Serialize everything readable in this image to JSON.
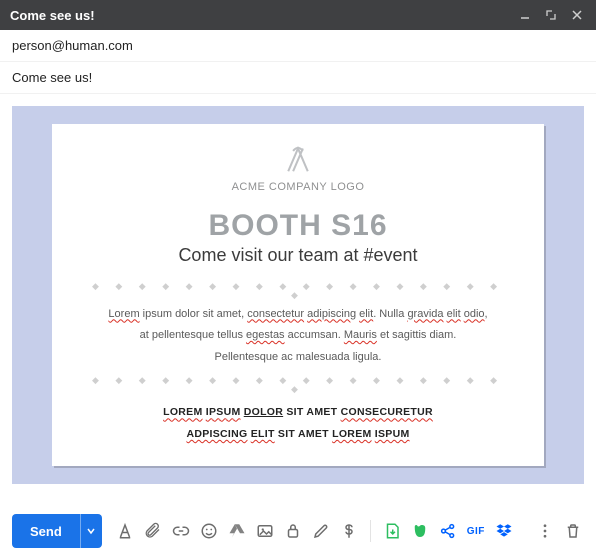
{
  "window": {
    "title": "Come see us!"
  },
  "to_field": "person@human.com",
  "subject": "Come see us!",
  "email": {
    "logo_text": "ACME COMPANY LOGO",
    "headline": "BOOTH S16",
    "tagline": "Come visit our team at #event",
    "body_line1_html": "<span class='sq'>Lorem</span> ipsum dolor sit amet, <span class='sq'>consectetur</span> <span class='sq'>adipiscing</span> <span class='sq'>elit</span>. Nulla <span class='sq'>gravida</span> <span class='sq'>elit</span> <span class='sq'>odio</span>,",
    "body_line2_html": "at pellentesque tellus <span class='sq'>egestas</span> accumsan. <span class='sq'>Mauris</span> et sagittis diam.",
    "body_line3_html": "Pellentesque ac malesuada ligula.",
    "bold_line1_html": "<span class='sq'>LOREM</span> <span class='sq'>IPSUM</span> <span class='u'>DOLOR</span> SIT AMET <span class='sq'>CONSECURETUR</span>",
    "bold_line2_html": "<span class='sq'>ADPISCING</span> <span class='sq'>ELIT</span> SIT AMET <span class='sq'>LOREM</span> <span class='sq'>ISPUM</span>"
  },
  "toolbar": {
    "send": "Send",
    "gif": "GIF"
  }
}
